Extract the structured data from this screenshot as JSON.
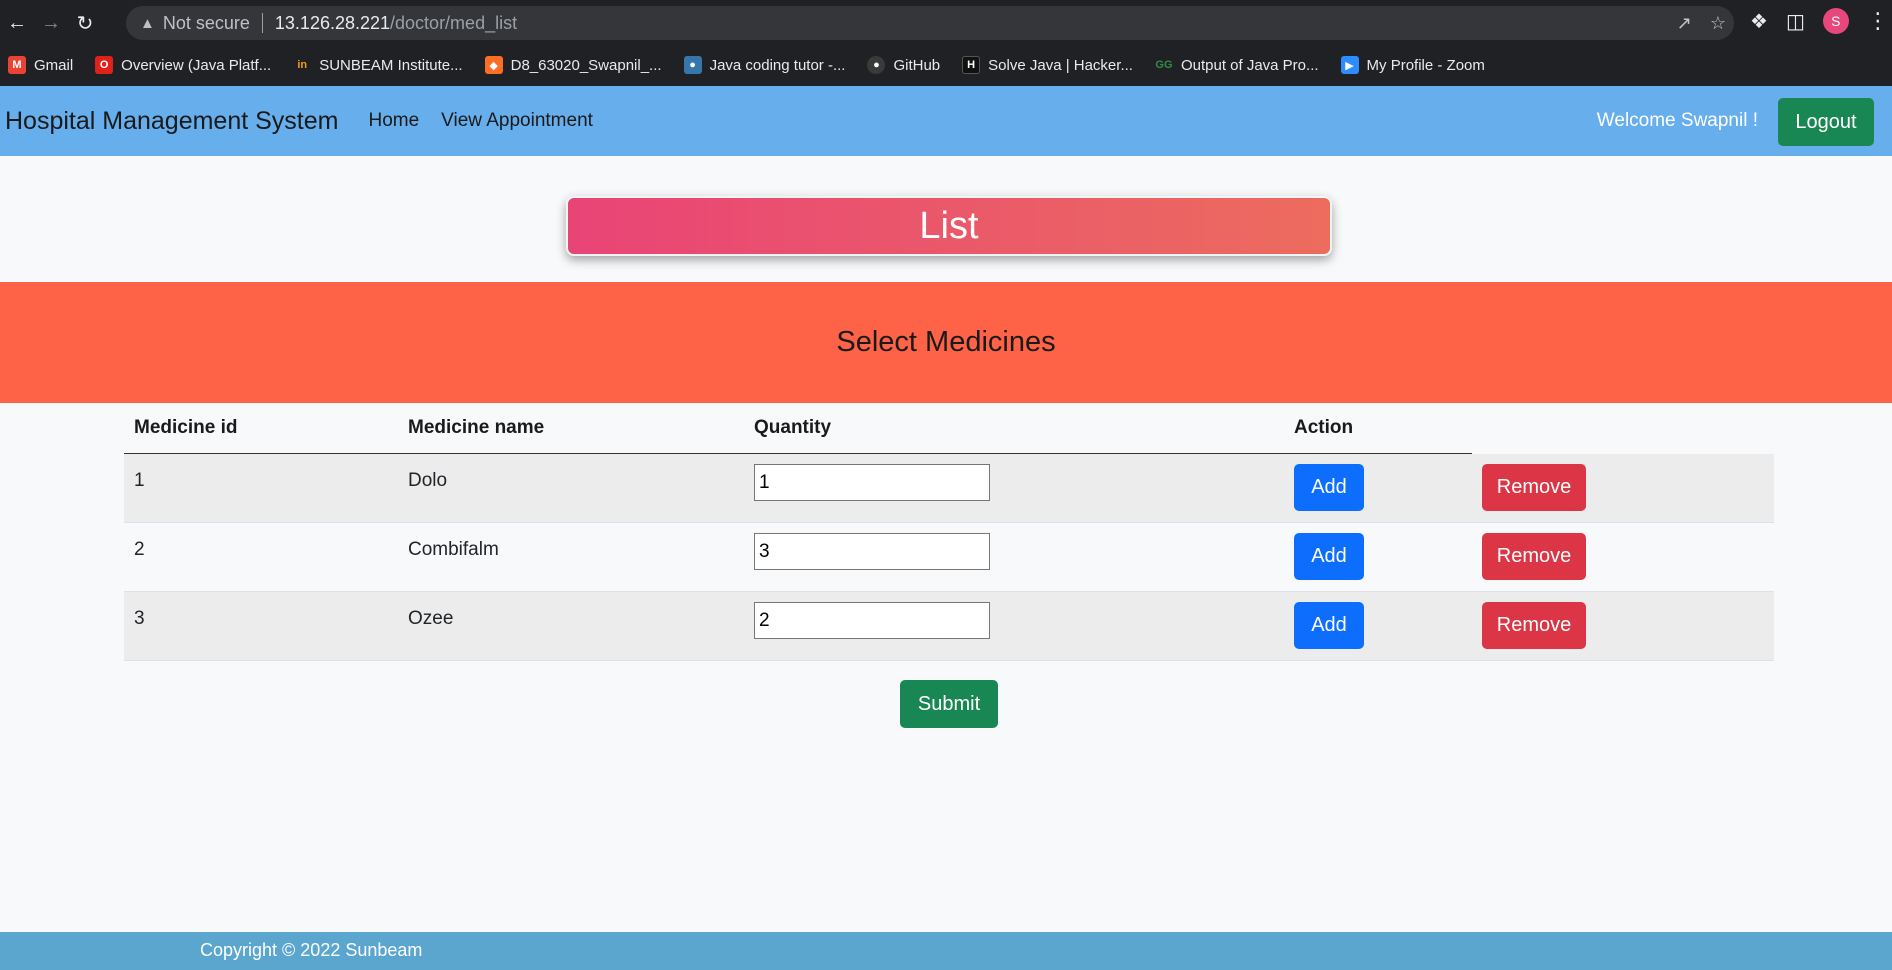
{
  "browser": {
    "url_warning": "Not secure",
    "url_host": "13.126.28.221",
    "url_path": "/doctor/med_list",
    "avatar_letter": "S",
    "bookmarks": [
      {
        "label": "Gmail",
        "icon": "gmail-icon",
        "color": "#ea4335"
      },
      {
        "label": "Overview (Java Platf...",
        "icon": "oracle-icon",
        "color": "#e0201b"
      },
      {
        "label": "SUNBEAM Institute...",
        "icon": "sunbeam-icon",
        "color": "#f39c12"
      },
      {
        "label": "D8_63020_Swapnil_...",
        "icon": "gitlab-icon",
        "color": "#fc6d26"
      },
      {
        "label": "Java coding tutor -...",
        "icon": "python-icon",
        "color": "#3776ab"
      },
      {
        "label": "GitHub",
        "icon": "github-icon",
        "color": "#24292e"
      },
      {
        "label": "Solve Java | Hacker...",
        "icon": "hackerrank-icon",
        "color": "#111111"
      },
      {
        "label": "Output of Java Pro...",
        "icon": "geeksforgeeks-icon",
        "color": "#2f8d46"
      },
      {
        "label": "My Profile - Zoom",
        "icon": "zoom-icon",
        "color": "#2d8cff"
      }
    ]
  },
  "navbar": {
    "brand": "Hospital Management System",
    "links": [
      "Home",
      "View Appointment"
    ],
    "welcome": "Welcome Swapnil !",
    "logout_label": "Logout"
  },
  "banner": {
    "title": "List",
    "subtitle": "Select Medicines"
  },
  "table": {
    "headers": [
      "Medicine id",
      "Medicine name",
      "Quantity",
      "Action"
    ],
    "rows": [
      {
        "id": "1",
        "name": "Dolo",
        "quantity": "1"
      },
      {
        "id": "2",
        "name": "Combifalm",
        "quantity": "3"
      },
      {
        "id": "3",
        "name": "Ozee",
        "quantity": "2"
      }
    ],
    "add_label": "Add",
    "remove_label": "Remove"
  },
  "submit_label": "Submit",
  "footer": {
    "copyright": "Copyright © 2022 Sunbeam"
  },
  "colors": {
    "navbar": "#67aeec",
    "band": "#ff6347",
    "logout": "#198754",
    "add": "#0d6efd",
    "remove": "#dc3545",
    "footer": "#5aa6cf"
  }
}
